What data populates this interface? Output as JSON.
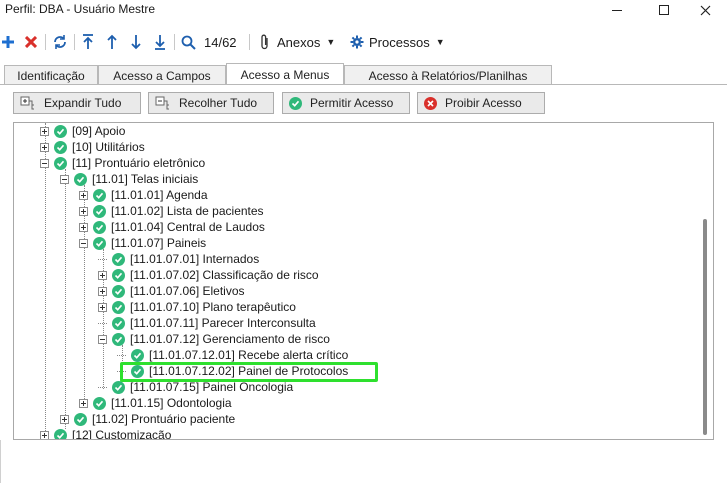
{
  "window": {
    "title": "Perfil: DBA - Usuário Mestre",
    "minimize_icon": "minimize-icon",
    "maximize_icon": "maximize-icon",
    "close_icon": "close-icon"
  },
  "toolbar": {
    "add_icon": "plus-icon",
    "delete_icon": "x-icon",
    "refresh_icon": "refresh-icon",
    "first_icon": "arrow-top-icon",
    "prev_icon": "arrow-up-icon",
    "next_icon": "arrow-down-icon",
    "last_icon": "arrow-bottom-icon",
    "search_icon": "search-icon",
    "record_counter": "14/62",
    "attachments_label": "Anexos",
    "processes_label": "Processos"
  },
  "tabs": [
    {
      "label": "Identificação",
      "active": false
    },
    {
      "label": "Acesso a Campos",
      "active": false
    },
    {
      "label": "Acesso a Menus",
      "active": true
    },
    {
      "label": "Acesso à Relatórios/Planilhas",
      "active": false
    }
  ],
  "actions": {
    "expand_all": "Expandir Tudo",
    "collapse_all": "Recolher Tudo",
    "allow_access": "Permitir Acesso",
    "deny_access": "Proibir Acesso"
  },
  "tree": {
    "items": [
      "[09] Apoio",
      "[10] Utilitários",
      "[11] Prontuário eletrônico",
      "[11.01] Telas iniciais",
      "[11.01.01] Agenda",
      "[11.01.02] Lista de pacientes",
      "[11.01.04] Central de Laudos",
      "[11.01.07] Paineis",
      "[11.01.07.01] Internados",
      "[11.01.07.02] Classificação de risco",
      "[11.01.07.06] Eletivos",
      "[11.01.07.10] Plano terapêutico",
      "[11.01.07.11] Parecer Interconsulta",
      "[11.01.07.12] Gerenciamento de risco",
      "[11.01.07.12.01] Recebe alerta crítico",
      "[11.01.07.12.02] Painel de Protocolos",
      "[11.01.07.15] Painel Oncologia",
      "[11.01.15] Odontologia",
      "[11.02] Prontuário paciente",
      "[12] Customização"
    ]
  },
  "colors": {
    "check_green": "#2fb87a",
    "highlight_green": "#2ee02e",
    "add_blue": "#1e6fd0",
    "delete_red": "#d9302b"
  }
}
